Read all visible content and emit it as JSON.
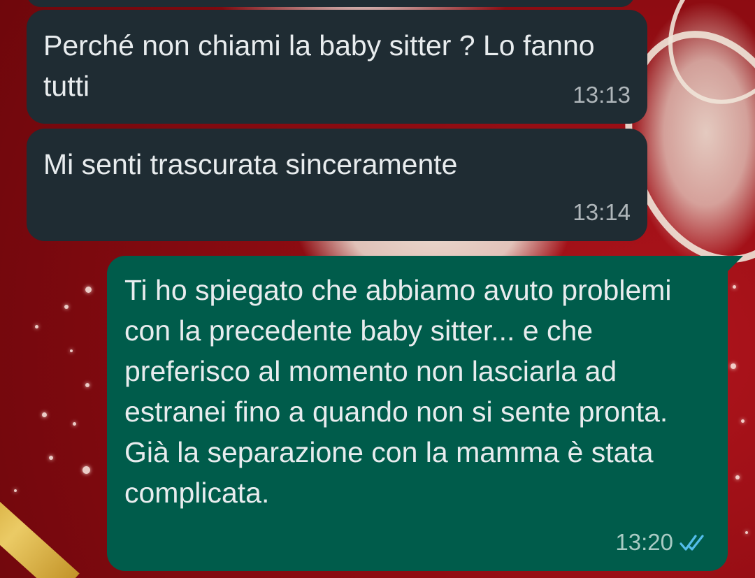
{
  "chat": {
    "messages": [
      {
        "direction": "incoming",
        "text": "Perché non chiami la baby sitter ? Lo fanno tutti",
        "time": "13:13"
      },
      {
        "direction": "incoming",
        "text": "Mi senti trascurata sinceramente",
        "time": "13:14"
      },
      {
        "direction": "outgoing",
        "text": "Ti ho spiegato che abbiamo avuto problemi con la precedente baby sitter... e che preferisco al momento non lasciarla ad estranei fino a quando non si sente pronta. Già la separazione con la mamma è stata complicata.",
        "time": "13:20",
        "status_icon": "double-check-read-icon",
        "status": "read"
      }
    ]
  },
  "colors": {
    "incoming_bubble": "#1f2c33",
    "outgoing_bubble": "#005c4b",
    "message_text": "#e8ecee",
    "read_tick": "#53bdeb",
    "wallpaper_red": "#8e0c12"
  }
}
